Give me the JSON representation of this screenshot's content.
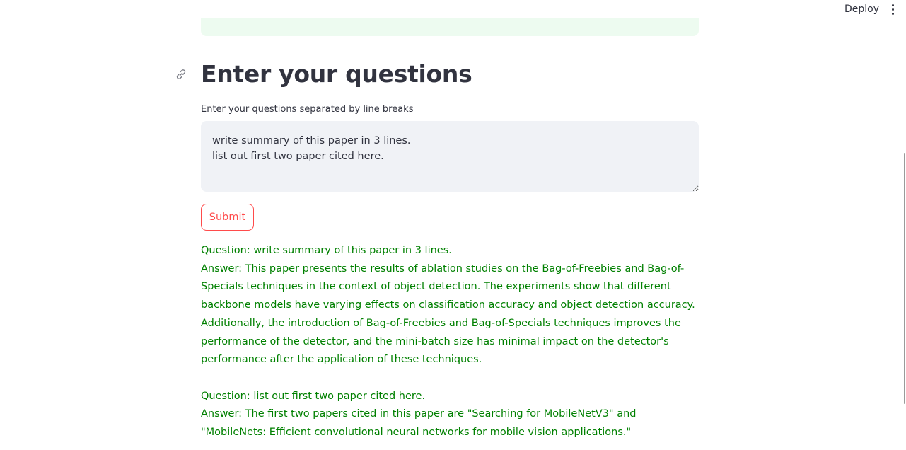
{
  "header": {
    "deploy_label": "Deploy",
    "menu_icon": "kebab-menu-icon"
  },
  "section": {
    "anchor_icon": "link-icon",
    "title": "Enter your questions",
    "input_label": "Enter your questions separated by line breaks",
    "input_value": "write summary of this paper in 3 lines.\nlist out first two paper cited here.",
    "submit_label": "Submit"
  },
  "results": [
    {
      "question": "Question: write summary of this paper in 3 lines.",
      "answer": "Answer: This paper presents the results of ablation studies on the Bag-of-Freebies and Bag-of-Specials techniques in the context of object detection. The experiments show that different backbone models have varying effects on classification accuracy and object detection accuracy. Additionally, the introduction of Bag-of-Freebies and Bag-of-Specials techniques improves the performance of the detector, and the mini-batch size has minimal impact on the detector's performance after the application of these techniques."
    },
    {
      "question": "Question: list out first two paper cited here.",
      "answer": "Answer: The first two papers cited in this paper are \"Searching for MobileNetV3\" and \"MobileNets: Efficient convolutional neural networks for mobile vision applications.\""
    }
  ],
  "colors": {
    "accent": "#ff4b4b",
    "result_text": "#008000",
    "input_bg": "#f0f2f6",
    "success_bg": "#edfbf0",
    "text": "#31333f"
  }
}
